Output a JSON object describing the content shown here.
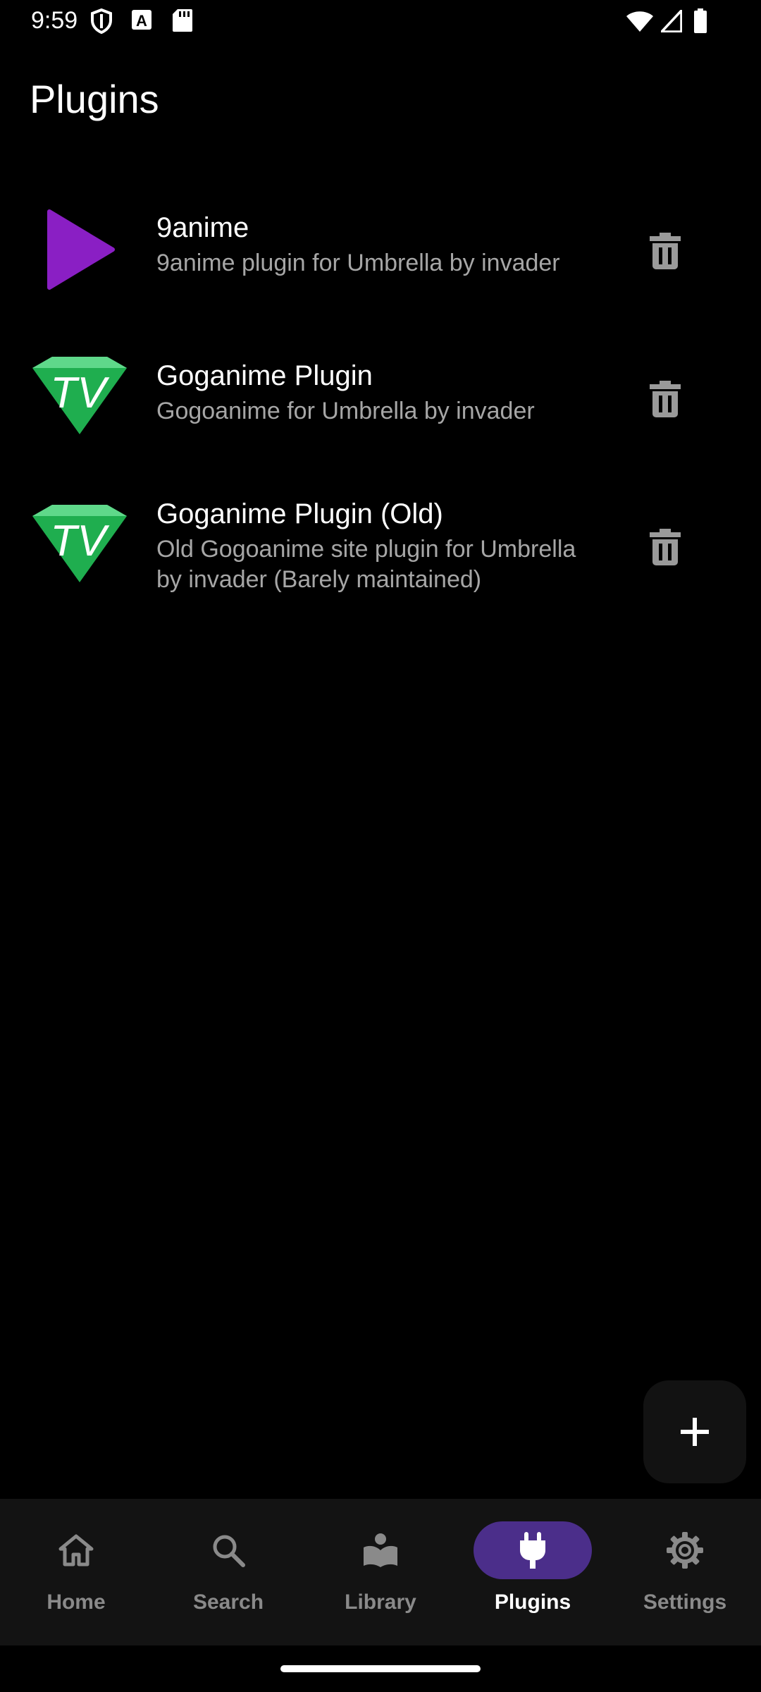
{
  "status_bar": {
    "time": "9:59",
    "left_icons": [
      "shield-icon",
      "font-icon",
      "sd-card-icon"
    ],
    "right_icons": [
      "wifi-icon",
      "signal-icon",
      "battery-icon"
    ]
  },
  "page": {
    "title": "Plugins"
  },
  "plugins": [
    {
      "name": "9anime",
      "description": "9anime plugin for Umbrella by invader",
      "icon": "play-triangle-icon",
      "accent": "#8a1fc4"
    },
    {
      "name": "Goganime Plugin",
      "description": "Gogoanime for Umbrella by invader",
      "icon": "tv-logo-icon",
      "accent": "#1fae4f"
    },
    {
      "name": "Goganime Plugin (Old)",
      "description": "Old Gogoanime site plugin for Umbrella by invader (Barely maintained)",
      "icon": "tv-logo-icon",
      "accent": "#1fae4f"
    }
  ],
  "fab": {
    "icon": "plus-icon"
  },
  "nav": {
    "items": [
      {
        "label": "Home",
        "icon": "home-icon"
      },
      {
        "label": "Search",
        "icon": "search-icon"
      },
      {
        "label": "Library",
        "icon": "library-icon"
      },
      {
        "label": "Plugins",
        "icon": "plug-icon",
        "active": true
      },
      {
        "label": "Settings",
        "icon": "gear-icon"
      }
    ],
    "active_color": "#4b2e8a"
  }
}
